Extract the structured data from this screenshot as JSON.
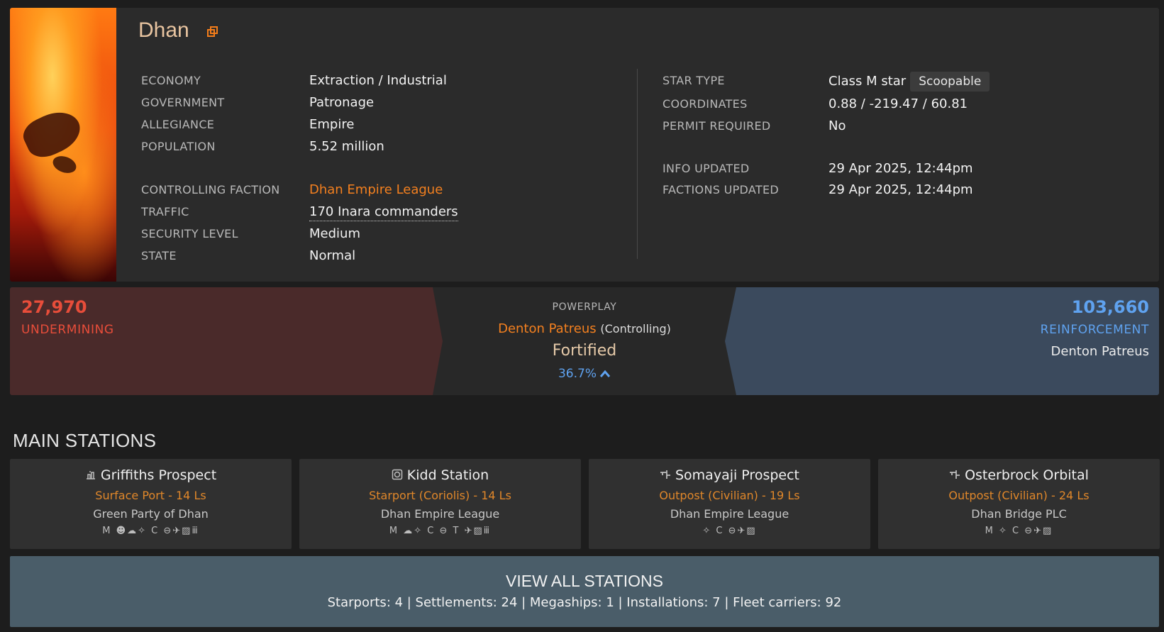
{
  "system": {
    "name": "Dhan",
    "info_left": [
      {
        "label": "ECONOMY",
        "value": "Extraction / Industrial"
      },
      {
        "label": "GOVERNMENT",
        "value": "Patronage"
      },
      {
        "label": "ALLEGIANCE",
        "value": "Empire"
      },
      {
        "label": "POPULATION",
        "value": "5.52 million"
      },
      {
        "label": "CONTROLLING FACTION",
        "value": "Dhan Empire League"
      },
      {
        "label": "TRAFFIC",
        "value": "170 Inara commanders"
      },
      {
        "label": "SECURITY LEVEL",
        "value": "Medium"
      },
      {
        "label": "STATE",
        "value": "Normal"
      }
    ],
    "info_right": [
      {
        "label": "STAR TYPE",
        "value": "Class M star",
        "badge": "Scoopable"
      },
      {
        "label": "COORDINATES",
        "value": "0.88 / -219.47 / 60.81"
      },
      {
        "label": "PERMIT REQUIRED",
        "value": "No"
      },
      {
        "label": "INFO UPDATED",
        "value": "29 Apr 2025, 12:44pm"
      },
      {
        "label": "FACTIONS UPDATED",
        "value": "29 Apr 2025, 12:44pm"
      }
    ]
  },
  "powerplay": {
    "heading": "POWERPLAY",
    "undermining_value": "27,970",
    "undermining_label": "UNDERMINING",
    "reinforcement_value": "103,660",
    "reinforcement_label": "REINFORCEMENT",
    "reinforcement_power": "Denton Patreus",
    "power": "Denton Patreus",
    "power_status": "(Controlling)",
    "state": "Fortified",
    "progress": "36.7%"
  },
  "stations_section": {
    "title": "MAIN STATIONS",
    "stations": [
      {
        "name": "Griffiths Prospect",
        "icon": "surface-port-icon",
        "type": "Surface Port - 14 Ls",
        "faction": "Green Party of Dhan",
        "services": "M ☻☁✧ C ⊖✈▨ⅲ"
      },
      {
        "name": "Kidd Station",
        "icon": "coriolis-icon",
        "type": "Starport (Coriolis) - 14 Ls",
        "faction": "Dhan Empire League",
        "services": "M ☁✧ C ⊖ T ✈▨ⅲ"
      },
      {
        "name": "Somayaji Prospect",
        "icon": "outpost-icon",
        "type": "Outpost (Civilian) - 19 Ls",
        "faction": "Dhan Empire League",
        "services": "✧ C ⊖✈▨"
      },
      {
        "name": "Osterbrock Orbital",
        "icon": "outpost-icon",
        "type": "Outpost (Civilian) - 24 Ls",
        "faction": "Dhan Bridge PLC",
        "services": "M ✧ C ⊖✈▨"
      }
    ],
    "view_all_label": "VIEW ALL STATIONS",
    "counts": "Starports: 4 | Settlements: 24 | Megaships: 1 | Installations: 7 | Fleet carriers: 92"
  },
  "colors": {
    "accent_orange": "#f4801f",
    "undermining_red": "#e84d3a",
    "reinforcement_blue": "#5fa2ef"
  }
}
